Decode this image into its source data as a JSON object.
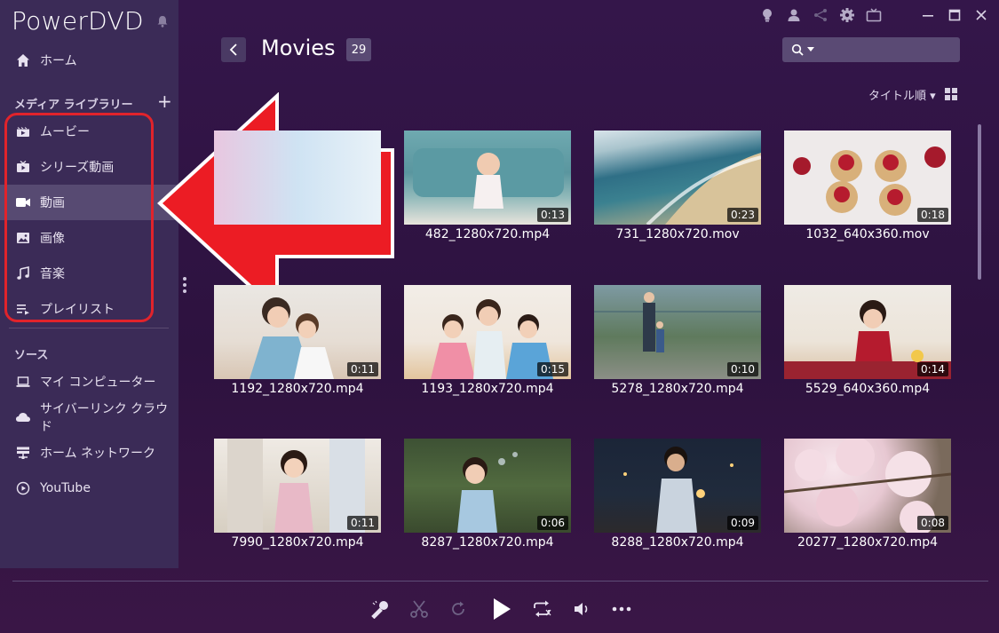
{
  "app": {
    "brand": "PowerDVD"
  },
  "nav": {
    "home_label": "ホーム",
    "media_library_title": "メディア ライブラリー",
    "add_label": "+",
    "library_items": [
      {
        "label": "ムービー",
        "icon": "film-icon",
        "active": false
      },
      {
        "label": "シリーズ動画",
        "icon": "tv-series-icon",
        "active": false
      },
      {
        "label": "動画",
        "icon": "video-camera-icon",
        "active": true
      },
      {
        "label": "画像",
        "icon": "image-icon",
        "active": false
      },
      {
        "label": "音楽",
        "icon": "music-note-icon",
        "active": false
      },
      {
        "label": "プレイリスト",
        "icon": "playlist-icon",
        "active": false
      }
    ],
    "source_title": "ソース",
    "source_items": [
      {
        "label": "マイ コンピューター",
        "icon": "laptop-icon"
      },
      {
        "label": "サイバーリンク クラウド",
        "icon": "cloud-icon"
      },
      {
        "label": "ホーム ネットワーク",
        "icon": "network-icon"
      },
      {
        "label": "YouTube",
        "icon": "youtube-icon"
      }
    ]
  },
  "header": {
    "title": "Movies",
    "count": "29",
    "search_placeholder": "",
    "sort_label": "タイトル順 ▾"
  },
  "tiles": [
    {
      "name": "482_1280x720.mp4",
      "duration": "0:13"
    },
    {
      "name": "731_1280x720.mov",
      "duration": "0:23"
    },
    {
      "name": "1032_640x360.mov",
      "duration": "0:18"
    },
    {
      "name": "1192_1280x720.mp4",
      "duration": "0:11"
    },
    {
      "name": "1193_1280x720.mp4",
      "duration": "0:15"
    },
    {
      "name": "5278_1280x720.mp4",
      "duration": "0:10"
    },
    {
      "name": "5529_640x360.mp4",
      "duration": "0:14"
    },
    {
      "name": "7990_1280x720.mp4",
      "duration": "0:11"
    },
    {
      "name": "8287_1280x720.mp4",
      "duration": "0:06"
    },
    {
      "name": "8288_1280x720.mp4",
      "duration": "0:09"
    },
    {
      "name": "20277_1280x720.mp4",
      "duration": "0:08"
    }
  ],
  "colors": {
    "accent_red": "#e1232b",
    "sidebar_bg": "#3b2b57",
    "active_bg": "#574a72"
  }
}
